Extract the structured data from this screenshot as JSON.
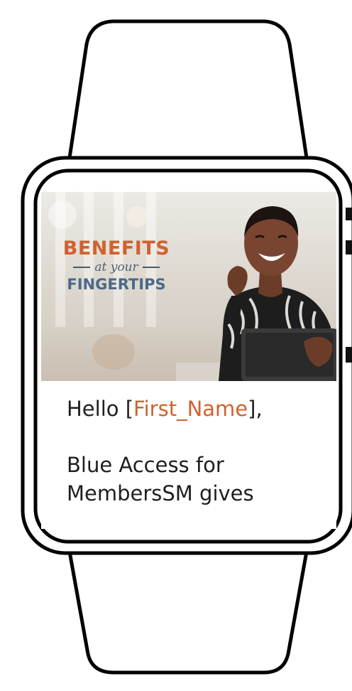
{
  "hero": {
    "logo_line1": "BENEFITS",
    "logo_line2": "at your",
    "logo_line3": "FINGERTIPS"
  },
  "greeting": {
    "prefix": "Hello [",
    "merge_field": "First_Name",
    "suffix": "],"
  },
  "body": {
    "line1": "Blue Access for",
    "line2": "MembersSM gives"
  },
  "colors": {
    "accent_orange": "#d0622f",
    "accent_blue": "#4a6a88",
    "text_dark": "#1f1f1f",
    "outline": "#000000"
  }
}
